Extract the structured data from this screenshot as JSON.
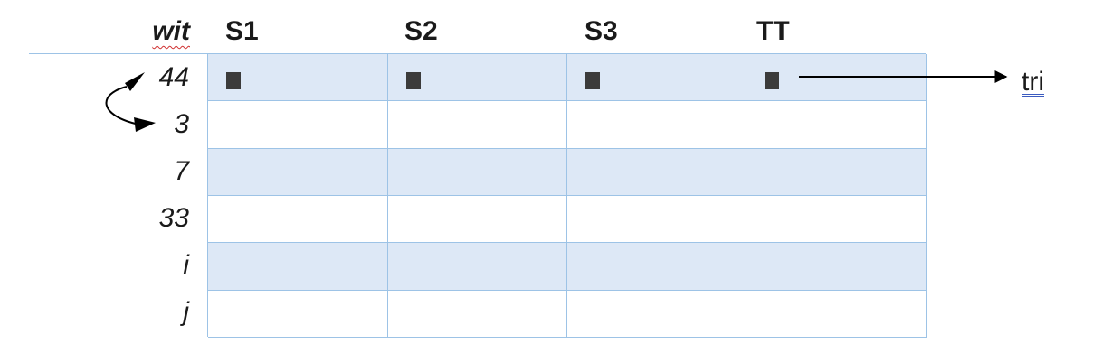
{
  "corner_label": "wit",
  "columns": [
    "S1",
    "S2",
    "S3",
    "TT"
  ],
  "rows": [
    "44",
    "3",
    "7",
    "33",
    "i",
    "j"
  ],
  "arrow_target_label": "tri",
  "colors": {
    "shaded_row": "#dde8f6",
    "grid_line": "#9dc3e6",
    "marker": "#3b3b3b"
  }
}
